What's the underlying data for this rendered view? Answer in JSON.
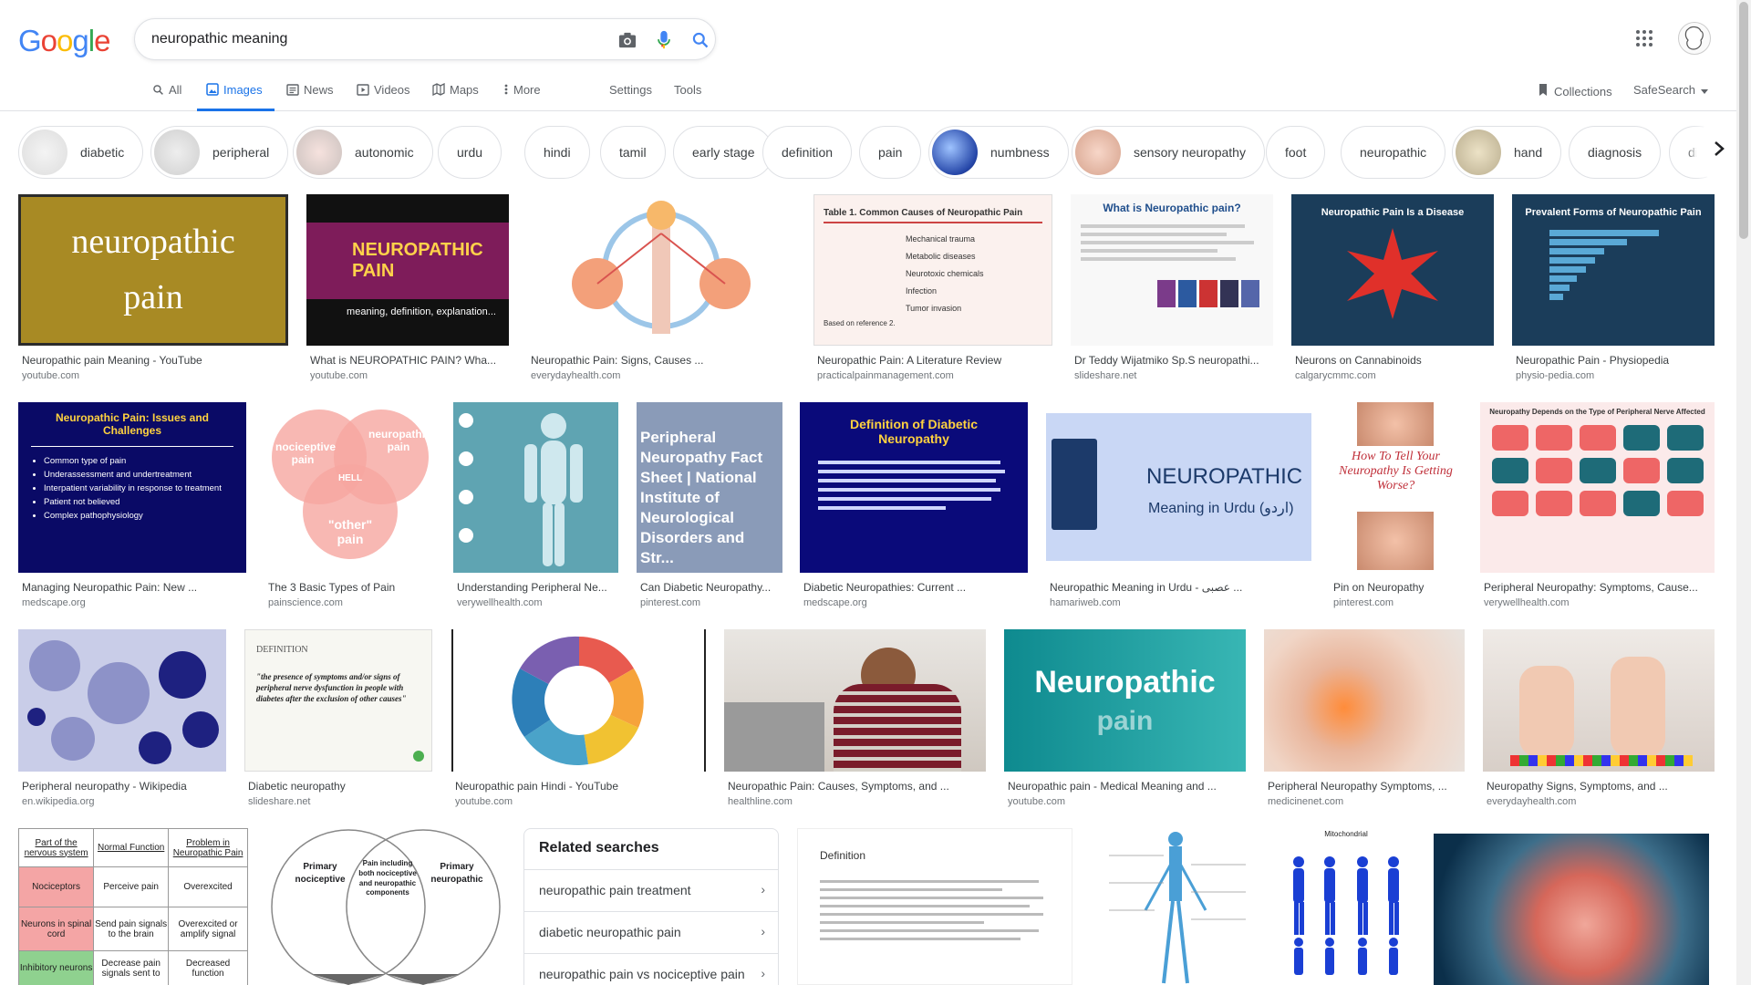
{
  "logo": {
    "letters": [
      "G",
      "o",
      "o",
      "g",
      "l",
      "e"
    ],
    "colors": [
      "#4285F4",
      "#EA4335",
      "#FBBC05",
      "#4285F4",
      "#34A853",
      "#EA4335"
    ]
  },
  "search": {
    "query": "neuropathic meaning",
    "icons": [
      "camera-icon",
      "microphone-icon",
      "search-icon"
    ]
  },
  "tabs": [
    {
      "label": "All",
      "icon": "search-icon"
    },
    {
      "label": "Images",
      "icon": "image-icon",
      "active": true
    },
    {
      "label": "News",
      "icon": "news-icon"
    },
    {
      "label": "Videos",
      "icon": "video-icon"
    },
    {
      "label": "Maps",
      "icon": "map-icon"
    },
    {
      "label": "More",
      "icon": "more-icon"
    }
  ],
  "tools": {
    "settings": "Settings",
    "tools": "Tools",
    "collections": "Collections",
    "safesearch": "SafeSearch"
  },
  "chips": [
    "diabetic",
    "peripheral",
    "autonomic",
    "urdu",
    "hindi",
    "tamil",
    "early stage",
    "definition",
    "pain",
    "numbness",
    "sensory neuropathy",
    "foot",
    "neuropathic",
    "hand",
    "diagnosis",
    "dia"
  ],
  "images": [
    {
      "caption": "Neuropathic pain Meaning - YouTube",
      "source": "youtube.com",
      "text": "neuropathic pain"
    },
    {
      "caption": "What is NEUROPATHIC PAIN? Wha...",
      "source": "youtube.com",
      "text": "NEUROPATHIC PAIN",
      "sub": "meaning, definition, explanation..."
    },
    {
      "caption": "Neuropathic Pain: Signs, Causes ...",
      "source": "everydayhealth.com"
    },
    {
      "caption": "Neuropathic Pain: A Literature Review",
      "source": "practicalpainmanagement.com",
      "text": "Table 1. Common Causes of Neuropathic Pain",
      "items": [
        "Mechanical trauma",
        "Metabolic diseases",
        "Neurotoxic chemicals",
        "Infection",
        "Tumor invasion"
      ],
      "foot": "Based on reference 2."
    },
    {
      "caption": "Dr Teddy Wijatmiko Sp.S neuropathi...",
      "source": "slideshare.net",
      "text": "What is Neuropathic pain?"
    },
    {
      "caption": "Neurons on Cannabinoids",
      "source": "calgarycmmc.com",
      "text": "Neuropathic Pain Is a Disease"
    },
    {
      "caption": "Neuropathic Pain - Physiopedia",
      "source": "physio-pedia.com",
      "text": "Prevalent Forms of Neuropathic Pain"
    },
    {
      "caption": "Managing Neuropathic Pain: New ...",
      "source": "medscape.org",
      "text": "Neuropathic Pain: Issues and Challenges",
      "items": [
        "Common type of pain",
        "Underassessment and undertreatment",
        "Interpatient variability in response to treatment",
        "Patient not believed",
        "Complex pathophysiology"
      ]
    },
    {
      "caption": "The 3 Basic Types of Pain",
      "source": "painscience.com",
      "text": "nociceptive pain",
      "sub": "neuropathic pain",
      "extra": "\"other\" pain"
    },
    {
      "caption": "Understanding Peripheral Ne...",
      "source": "verywellhealth.com"
    },
    {
      "caption": "Can Diabetic Neuropathy...",
      "source": "pinterest.com",
      "text": "Peripheral Neuropathy Fact Sheet | National Institute of Neurological Disorders and Str..."
    },
    {
      "caption": "Diabetic Neuropathies: Current ...",
      "source": "medscape.org",
      "text": "Definition of Diabetic Neuropathy"
    },
    {
      "caption": "Neuropathic Meaning in Urdu - عصبی ...",
      "source": "hamariweb.com",
      "text": "NEUROPATHIC",
      "sub": "Meaning in Urdu (اردو)"
    },
    {
      "caption": "Pin on Neuropathy",
      "source": "pinterest.com",
      "text": "How To Tell Your Neuropathy Is Getting Worse?"
    },
    {
      "caption": "Peripheral Neuropathy: Symptoms, Cause...",
      "source": "verywellhealth.com",
      "text": "Neuropathy Depends on the Type of Peripheral Nerve Affected"
    },
    {
      "caption": "Peripheral neuropathy - Wikipedia",
      "source": "en.wikipedia.org"
    },
    {
      "caption": "Diabetic neuropathy",
      "source": "slideshare.net",
      "text": "DEFINITION",
      "sub": "\"the presence of symptoms and/or signs of peripheral nerve dysfunction in people with diabetes after the exclusion of other causes\""
    },
    {
      "caption": "Neuropathic pain Hindi - YouTube",
      "source": "youtube.com"
    },
    {
      "caption": "Neuropathic Pain: Causes, Symptoms, and ...",
      "source": "healthline.com"
    },
    {
      "caption": "Neuropathic pain - Medical Meaning and ...",
      "source": "youtube.com",
      "text": "Neuropathic",
      "sub": "pain"
    },
    {
      "caption": "Peripheral Neuropathy Symptoms, ...",
      "source": "medicinenet.com"
    },
    {
      "caption": "Neuropathy Signs, Symptoms, and ...",
      "source": "everydayhealth.com"
    }
  ],
  "bottom_row": {
    "table": {
      "headers": [
        "Part of the nervous system",
        "Normal Function",
        "Problem in Neuropathic Pain"
      ],
      "rows": [
        [
          "Nociceptors",
          "Perceive pain",
          "Overexcited"
        ],
        [
          "Neurons in spinal cord",
          "Send pain signals to the brain",
          "Overexcited or amplify signal"
        ],
        [
          "Inhibitory neurons",
          "Decrease pain signals sent to",
          "Decreased function"
        ]
      ]
    },
    "venn": {
      "left": "Primary nociceptive",
      "middle": "Pain including both nociceptive and neuropathic components",
      "right": "Primary neuropathic"
    },
    "definition": "Definition",
    "mito": "Mitochondrial"
  },
  "related": {
    "title": "Related searches",
    "items": [
      "neuropathic pain treatment",
      "diabetic neuropathic pain",
      "neuropathic pain vs nociceptive pain"
    ]
  }
}
